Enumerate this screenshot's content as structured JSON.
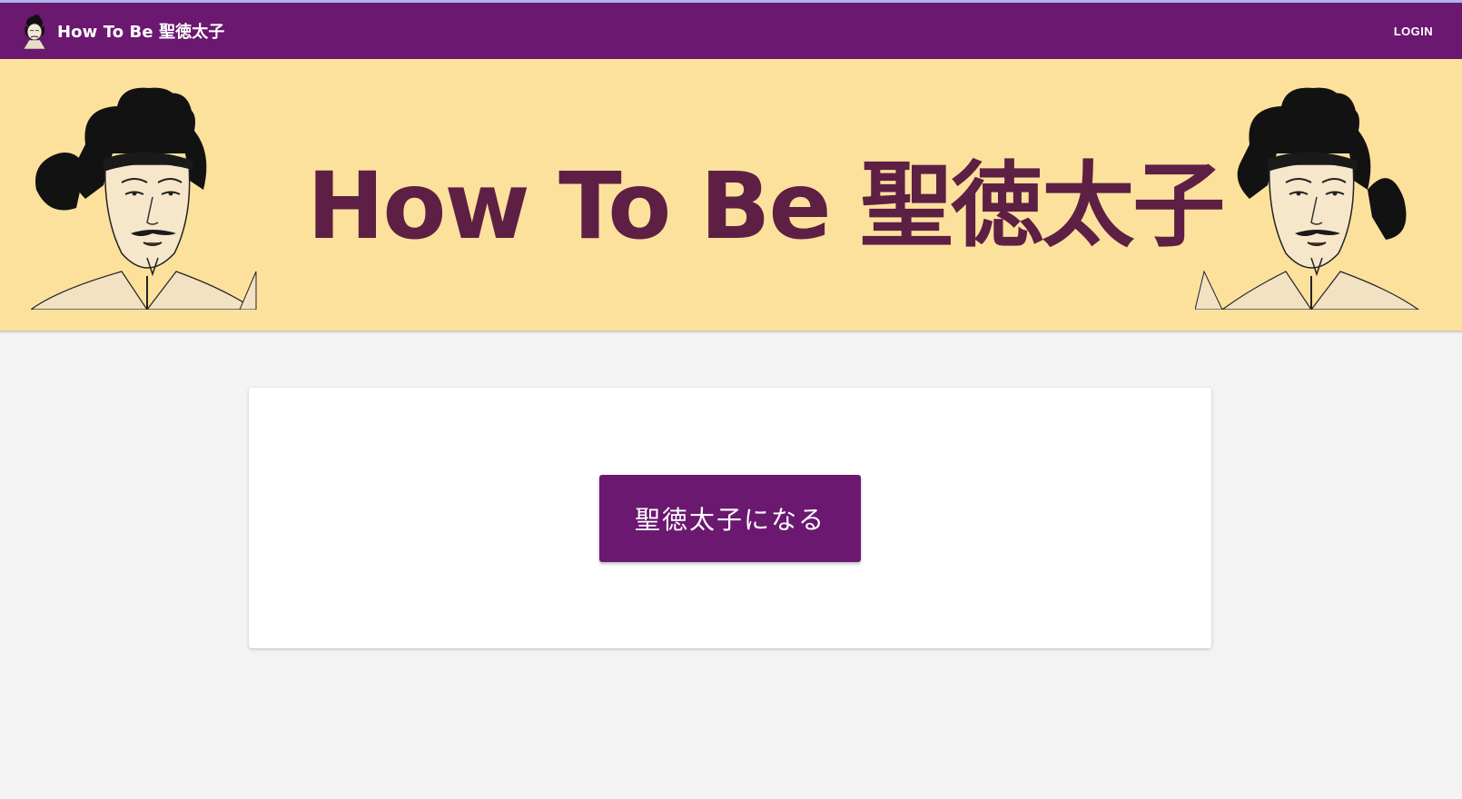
{
  "app": {
    "title": "How To Be  聖徳太子",
    "logo_icon": "shotoku-taishi-portrait-icon"
  },
  "navbar": {
    "login_label": "LOGIN",
    "background_color": "#6b1870"
  },
  "banner": {
    "title": "How To Be 聖徳太子",
    "background_color": "#fce19c",
    "text_color": "#5e1f45",
    "left_image_icon": "shotoku-taishi-portrait-icon",
    "right_image_icon": "shotoku-taishi-portrait-icon"
  },
  "main": {
    "cta_label": "聖徳太子になる",
    "button_color": "#6b1870"
  }
}
